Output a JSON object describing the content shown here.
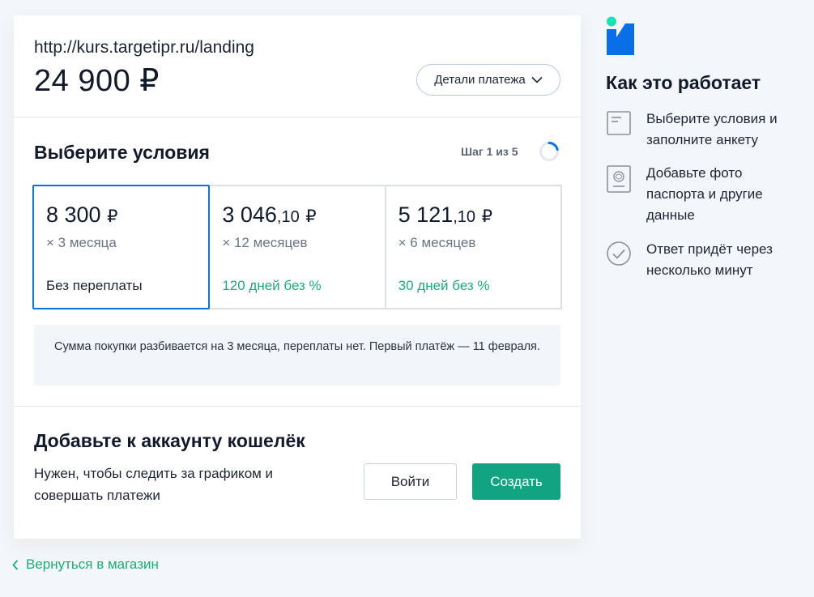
{
  "header": {
    "merchant_url": "http://kurs.targetipr.ru/landing",
    "amount": "24 900 ₽",
    "details_button": "Детали платежа"
  },
  "terms": {
    "title": "Выберите условия",
    "step": "Шаг 1 из 5",
    "step_progress": 0.2,
    "plans": [
      {
        "amount": "8 300",
        "kopecks": "",
        "currency": "₽",
        "term": "× 3 месяца",
        "note": "Без переплаты",
        "selected": true
      },
      {
        "amount": "3 046",
        "kopecks": ",10",
        "currency": "₽",
        "term": "× 12 месяцев",
        "note": "120 дней без %",
        "selected": false
      },
      {
        "amount": "5 121",
        "kopecks": ",10",
        "currency": "₽",
        "term": "× 6 месяцев",
        "note": "30 дней без %",
        "selected": false
      }
    ],
    "info": "Сумма покупки разбивается на 3 месяца, переплаты нет. Первый платёж — 11 февраля."
  },
  "wallet": {
    "title": "Добавьте к аккаунту кошелёк",
    "description": "Нужен, чтобы следить за графиком и совершать платежи",
    "login_button": "Войти",
    "create_button": "Создать"
  },
  "back_link": "Вернуться в магазин",
  "how_it_works": {
    "title": "Как это работает",
    "items": [
      {
        "icon": "form-icon",
        "text": "Выберите условия и заполните анкету"
      },
      {
        "icon": "passport-icon",
        "text": "Добавьте фото паспорта и другие данные"
      },
      {
        "icon": "check-circle-icon",
        "text": "Ответ придёт через несколько минут"
      }
    ]
  },
  "colors": {
    "accent_blue": "#0a73e0",
    "accent_green": "#12a380",
    "link_green": "#1ea97c",
    "logo_teal": "#1de0b5",
    "logo_blue": "#0a6fe6"
  }
}
